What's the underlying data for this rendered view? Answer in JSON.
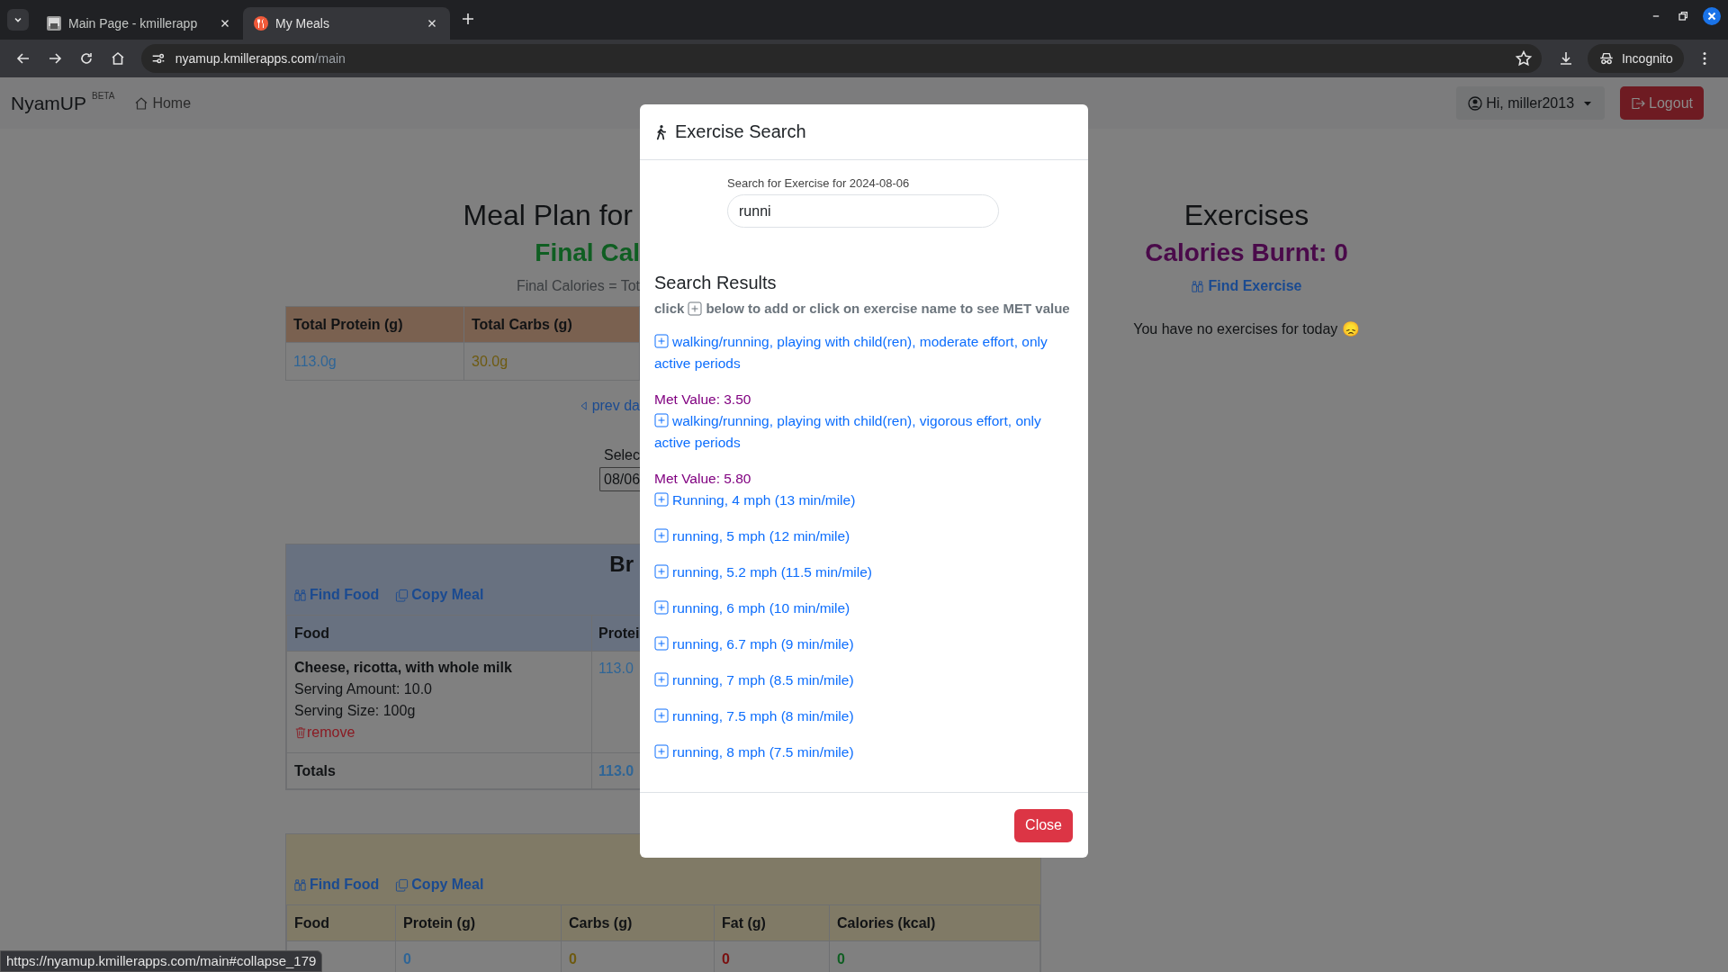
{
  "browser": {
    "tabs": [
      {
        "title": "Main Page - kmillerapp",
        "selected": false,
        "kind": "photo"
      },
      {
        "title": "My Meals",
        "selected": true,
        "kind": "meals"
      }
    ],
    "url": "nyamup.kmillerapps.com/main",
    "profile": "Incognito",
    "status_url": "https://nyamup.kmillerapps.com/main#collapse_179"
  },
  "navbar": {
    "brand": "NyamUP",
    "badge": "BETA",
    "links": [
      "Home"
    ],
    "user": "Hi, miller2013",
    "logout": "Logout"
  },
  "meal_plan": {
    "title": "Meal Plan for",
    "final_calories": "Final Cal",
    "formula": "Final Calories = Tot",
    "totals": {
      "columns": [
        "Total Protein (g)",
        "Total Carbs (g)"
      ],
      "values": [
        "113.0g",
        "30.0g"
      ]
    },
    "prev_day": "prev da",
    "date_label": "Selec",
    "date_value": "08/06",
    "meals": [
      {
        "title": "Br",
        "color": "#687180",
        "actions": [
          "Find Food",
          "Copy Meal"
        ],
        "columns": [
          "Food",
          "Protei"
        ],
        "items": [
          {
            "name": "Cheese, ricotta, with whole milk",
            "serving_amount": "Serving Amount: 10.0",
            "serving_size": "Serving Size: 100g",
            "remove": "remove",
            "values": [
              "113.0"
            ]
          }
        ],
        "totals": {
          "label": "Totals",
          "values": [
            "113.0"
          ]
        }
      },
      {
        "color": "#807a66",
        "actions": [
          "Find Food",
          "Copy Meal"
        ],
        "columns": [
          "Food",
          "Protein (g)",
          "Carbs (g)",
          "Fat (g)",
          "Calories (kcal)"
        ],
        "totals": {
          "values": [
            "0",
            "0",
            "0",
            "0"
          ]
        }
      }
    ]
  },
  "exercises": {
    "title": "Exercises",
    "calories_burnt": "Calories Burnt: 0",
    "find": "Find Exercise",
    "empty": "You have no exercises for today 😞"
  },
  "modal": {
    "title": "Exercise Search",
    "search_label": "Search for Exercise for 2024-08-06",
    "search_value": "runni",
    "results_title": "Search Results",
    "hint_before": "click",
    "hint_after": "below to add or click on exercise name to see MET value",
    "results": [
      {
        "name": "walking/running, playing with child(ren), moderate effort, only active periods",
        "met_value": "Met Value: 3.50"
      },
      {
        "name": "walking/running, playing with child(ren), vigorous effort, only active periods",
        "met_value": "Met Value: 5.80"
      },
      {
        "name": "Running, 4 mph (13 min/mile)"
      },
      {
        "name": "running, 5 mph (12 min/mile)"
      },
      {
        "name": "running, 5.2 mph (11.5 min/mile)"
      },
      {
        "name": "running, 6 mph (10 min/mile)"
      },
      {
        "name": "running, 6.7 mph (9 min/mile)"
      },
      {
        "name": "running, 7 mph (8.5 min/mile)"
      },
      {
        "name": "running, 7.5 mph (8 min/mile)"
      },
      {
        "name": "running, 8 mph (7.5 min/mile)"
      }
    ],
    "close": "Close"
  }
}
